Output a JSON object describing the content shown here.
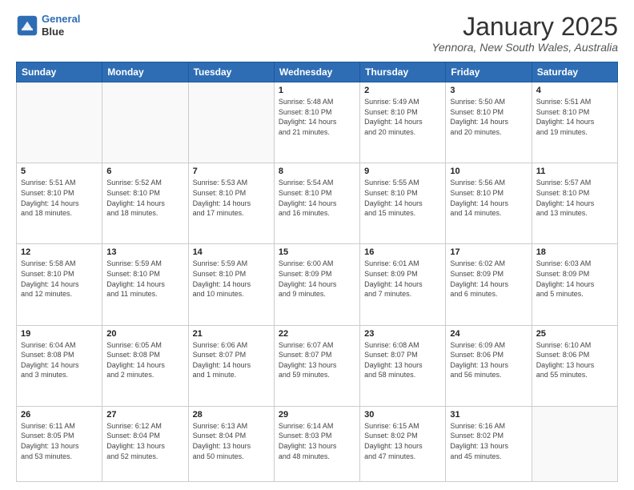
{
  "header": {
    "logo_line1": "General",
    "logo_line2": "Blue",
    "month": "January 2025",
    "location": "Yennora, New South Wales, Australia"
  },
  "weekdays": [
    "Sunday",
    "Monday",
    "Tuesday",
    "Wednesday",
    "Thursday",
    "Friday",
    "Saturday"
  ],
  "weeks": [
    [
      {
        "day": "",
        "text": ""
      },
      {
        "day": "",
        "text": ""
      },
      {
        "day": "",
        "text": ""
      },
      {
        "day": "1",
        "text": "Sunrise: 5:48 AM\nSunset: 8:10 PM\nDaylight: 14 hours\nand 21 minutes."
      },
      {
        "day": "2",
        "text": "Sunrise: 5:49 AM\nSunset: 8:10 PM\nDaylight: 14 hours\nand 20 minutes."
      },
      {
        "day": "3",
        "text": "Sunrise: 5:50 AM\nSunset: 8:10 PM\nDaylight: 14 hours\nand 20 minutes."
      },
      {
        "day": "4",
        "text": "Sunrise: 5:51 AM\nSunset: 8:10 PM\nDaylight: 14 hours\nand 19 minutes."
      }
    ],
    [
      {
        "day": "5",
        "text": "Sunrise: 5:51 AM\nSunset: 8:10 PM\nDaylight: 14 hours\nand 18 minutes."
      },
      {
        "day": "6",
        "text": "Sunrise: 5:52 AM\nSunset: 8:10 PM\nDaylight: 14 hours\nand 18 minutes."
      },
      {
        "day": "7",
        "text": "Sunrise: 5:53 AM\nSunset: 8:10 PM\nDaylight: 14 hours\nand 17 minutes."
      },
      {
        "day": "8",
        "text": "Sunrise: 5:54 AM\nSunset: 8:10 PM\nDaylight: 14 hours\nand 16 minutes."
      },
      {
        "day": "9",
        "text": "Sunrise: 5:55 AM\nSunset: 8:10 PM\nDaylight: 14 hours\nand 15 minutes."
      },
      {
        "day": "10",
        "text": "Sunrise: 5:56 AM\nSunset: 8:10 PM\nDaylight: 14 hours\nand 14 minutes."
      },
      {
        "day": "11",
        "text": "Sunrise: 5:57 AM\nSunset: 8:10 PM\nDaylight: 14 hours\nand 13 minutes."
      }
    ],
    [
      {
        "day": "12",
        "text": "Sunrise: 5:58 AM\nSunset: 8:10 PM\nDaylight: 14 hours\nand 12 minutes."
      },
      {
        "day": "13",
        "text": "Sunrise: 5:59 AM\nSunset: 8:10 PM\nDaylight: 14 hours\nand 11 minutes."
      },
      {
        "day": "14",
        "text": "Sunrise: 5:59 AM\nSunset: 8:10 PM\nDaylight: 14 hours\nand 10 minutes."
      },
      {
        "day": "15",
        "text": "Sunrise: 6:00 AM\nSunset: 8:09 PM\nDaylight: 14 hours\nand 9 minutes."
      },
      {
        "day": "16",
        "text": "Sunrise: 6:01 AM\nSunset: 8:09 PM\nDaylight: 14 hours\nand 7 minutes."
      },
      {
        "day": "17",
        "text": "Sunrise: 6:02 AM\nSunset: 8:09 PM\nDaylight: 14 hours\nand 6 minutes."
      },
      {
        "day": "18",
        "text": "Sunrise: 6:03 AM\nSunset: 8:09 PM\nDaylight: 14 hours\nand 5 minutes."
      }
    ],
    [
      {
        "day": "19",
        "text": "Sunrise: 6:04 AM\nSunset: 8:08 PM\nDaylight: 14 hours\nand 3 minutes."
      },
      {
        "day": "20",
        "text": "Sunrise: 6:05 AM\nSunset: 8:08 PM\nDaylight: 14 hours\nand 2 minutes."
      },
      {
        "day": "21",
        "text": "Sunrise: 6:06 AM\nSunset: 8:07 PM\nDaylight: 14 hours\nand 1 minute."
      },
      {
        "day": "22",
        "text": "Sunrise: 6:07 AM\nSunset: 8:07 PM\nDaylight: 13 hours\nand 59 minutes."
      },
      {
        "day": "23",
        "text": "Sunrise: 6:08 AM\nSunset: 8:07 PM\nDaylight: 13 hours\nand 58 minutes."
      },
      {
        "day": "24",
        "text": "Sunrise: 6:09 AM\nSunset: 8:06 PM\nDaylight: 13 hours\nand 56 minutes."
      },
      {
        "day": "25",
        "text": "Sunrise: 6:10 AM\nSunset: 8:06 PM\nDaylight: 13 hours\nand 55 minutes."
      }
    ],
    [
      {
        "day": "26",
        "text": "Sunrise: 6:11 AM\nSunset: 8:05 PM\nDaylight: 13 hours\nand 53 minutes."
      },
      {
        "day": "27",
        "text": "Sunrise: 6:12 AM\nSunset: 8:04 PM\nDaylight: 13 hours\nand 52 minutes."
      },
      {
        "day": "28",
        "text": "Sunrise: 6:13 AM\nSunset: 8:04 PM\nDaylight: 13 hours\nand 50 minutes."
      },
      {
        "day": "29",
        "text": "Sunrise: 6:14 AM\nSunset: 8:03 PM\nDaylight: 13 hours\nand 48 minutes."
      },
      {
        "day": "30",
        "text": "Sunrise: 6:15 AM\nSunset: 8:02 PM\nDaylight: 13 hours\nand 47 minutes."
      },
      {
        "day": "31",
        "text": "Sunrise: 6:16 AM\nSunset: 8:02 PM\nDaylight: 13 hours\nand 45 minutes."
      },
      {
        "day": "",
        "text": ""
      }
    ]
  ]
}
